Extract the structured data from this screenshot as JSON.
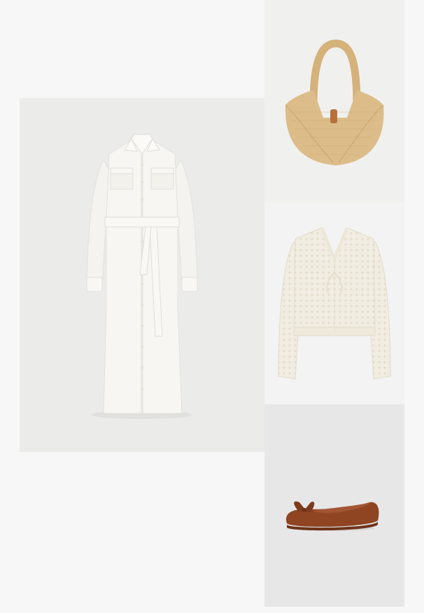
{
  "collage": {
    "items": [
      {
        "id": "dress",
        "name": "white-belted-shirt-dress"
      },
      {
        "id": "bag",
        "name": "woven-straw-tote-bag"
      },
      {
        "id": "cardigan",
        "name": "cream-crochet-tie-front-cardigan"
      },
      {
        "id": "flats",
        "name": "brown-suede-bow-ballet-flat"
      }
    ]
  },
  "colors": {
    "page_background": "#f7f7f7",
    "dress": "#f6f5f1",
    "straw": "#d9bb86",
    "leather_tab": "#b8703a",
    "cardigan": "#f1ede2",
    "suede": "#8f4422"
  }
}
